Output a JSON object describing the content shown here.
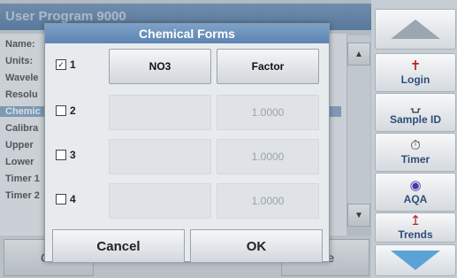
{
  "background": {
    "title": "User Program   9000",
    "rows": [
      "Name:",
      "Units:",
      "Wavele",
      "Resolu",
      "Chemic",
      "Calibra",
      "Upper",
      "Lower",
      "Timer 1",
      "Timer 2"
    ],
    "bottom_left": "Ca",
    "bottom_right": "ore"
  },
  "sidebar": {
    "login": "Login",
    "sample_id": "Sample ID",
    "timer": "Timer",
    "aqa": "AQA",
    "trends": "Trends"
  },
  "dialog": {
    "title": "Chemical Forms",
    "rows": [
      {
        "number": "1",
        "checked": true,
        "form": "NO3",
        "factor": "Factor"
      },
      {
        "number": "2",
        "checked": false,
        "form": "",
        "factor": "1.0000"
      },
      {
        "number": "3",
        "checked": false,
        "form": "",
        "factor": "1.0000"
      },
      {
        "number": "4",
        "checked": false,
        "form": "",
        "factor": "1.0000"
      }
    ],
    "cancel": "Cancel",
    "ok": "OK"
  }
}
